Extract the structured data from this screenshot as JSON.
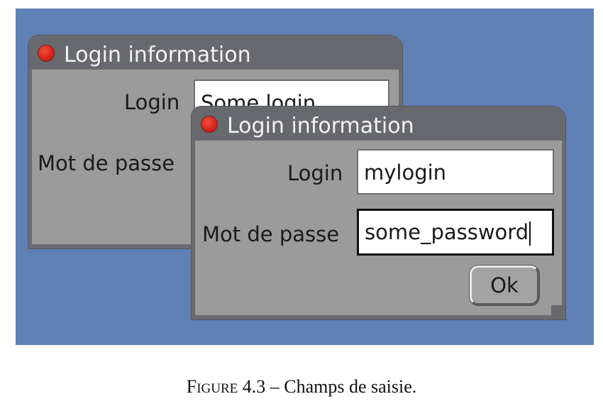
{
  "back_window": {
    "title": "Login information",
    "login_label": "Login",
    "login_value": "Some login",
    "password_label": "Mot de passe"
  },
  "front_window": {
    "title": "Login information",
    "login_label": "Login",
    "login_value": "mylogin",
    "password_label": "Mot de passe",
    "password_value": "some_password",
    "ok_label": "Ok"
  },
  "caption": {
    "figure_word_first": "F",
    "figure_word_rest": "IGURE",
    "text": "4.3 – Champs de saisie."
  },
  "colors": {
    "desktop": "#5f80b4",
    "window_body": "#9b9b9b",
    "titlebar": "#67696f",
    "close_dot": "#d8241a"
  }
}
